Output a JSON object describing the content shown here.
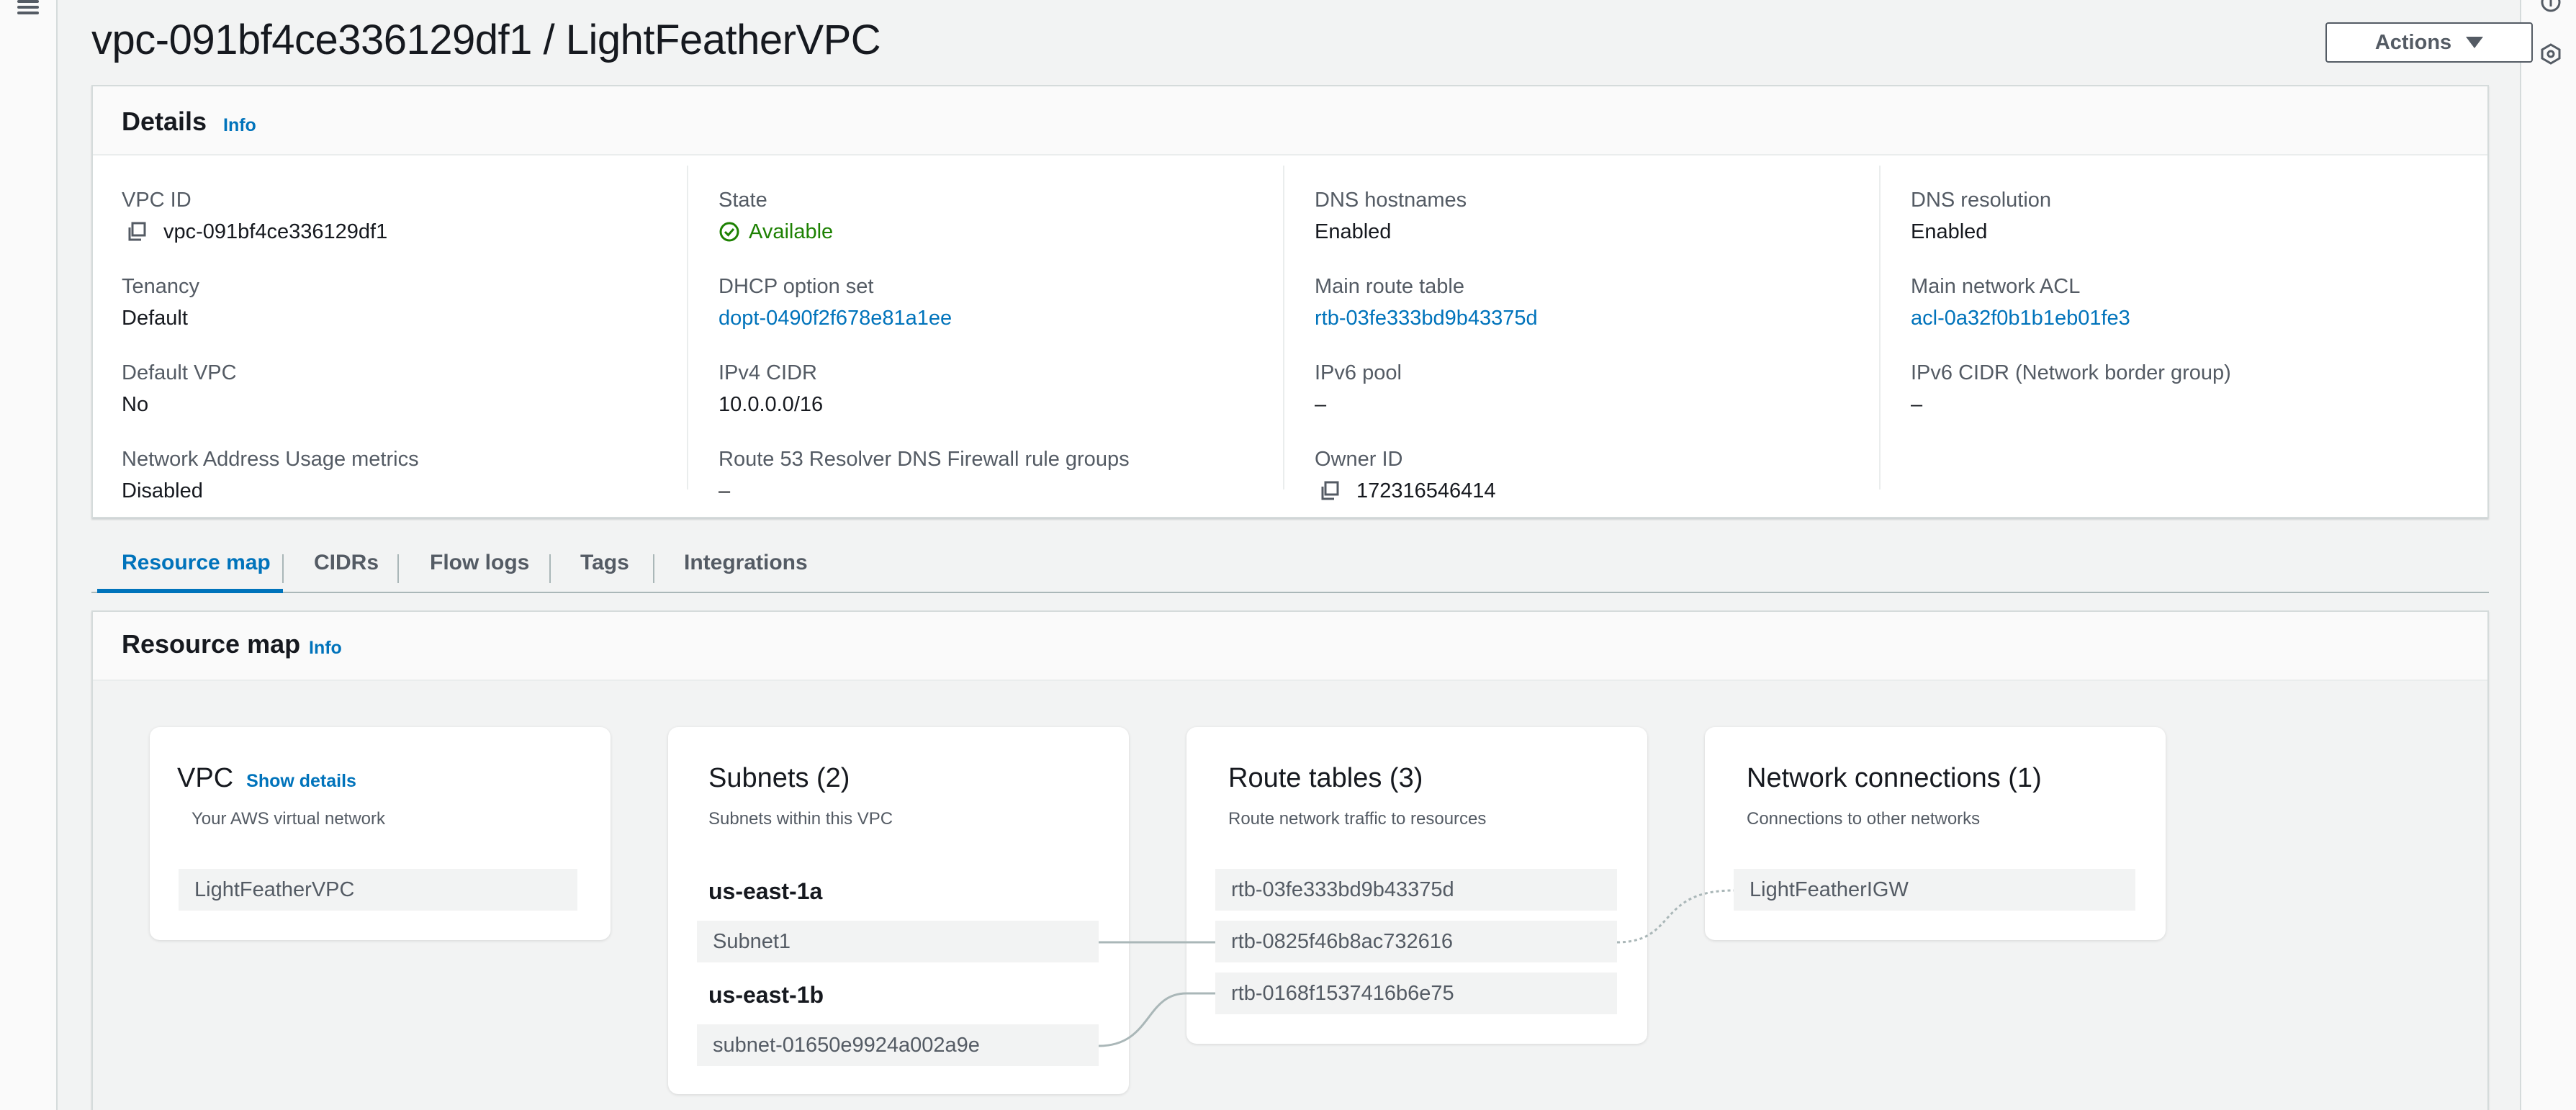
{
  "page": {
    "title": "vpc-091bf4ce336129df1 / LightFeatherVPC",
    "actions_label": "Actions"
  },
  "details": {
    "title": "Details",
    "info": "Info",
    "columns": [
      [
        {
          "label": "VPC ID",
          "value": "vpc-091bf4ce336129df1",
          "copyable": true
        },
        {
          "label": "Tenancy",
          "value": "Default"
        },
        {
          "label": "Default VPC",
          "value": "No"
        },
        {
          "label": "Network Address Usage metrics",
          "value": "Disabled"
        }
      ],
      [
        {
          "label": "State",
          "value": "Available",
          "status": "success"
        },
        {
          "label": "DHCP option set",
          "value": "dopt-0490f2f678e81a1ee",
          "link": true
        },
        {
          "label": "IPv4 CIDR",
          "value": "10.0.0.0/16"
        },
        {
          "label": "Route 53 Resolver DNS Firewall rule groups",
          "value": "–"
        }
      ],
      [
        {
          "label": "DNS hostnames",
          "value": "Enabled"
        },
        {
          "label": "Main route table",
          "value": "rtb-03fe333bd9b43375d",
          "link": true
        },
        {
          "label": "IPv6 pool",
          "value": "–"
        },
        {
          "label": "Owner ID",
          "value": "172316546414",
          "copyable": true
        }
      ],
      [
        {
          "label": "DNS resolution",
          "value": "Enabled"
        },
        {
          "label": "Main network ACL",
          "value": "acl-0a32f0b1b1eb01fe3",
          "link": true
        },
        {
          "label": "IPv6 CIDR (Network border group)",
          "value": "–"
        }
      ]
    ]
  },
  "tabs": [
    "Resource map",
    "CIDRs",
    "Flow logs",
    "Tags",
    "Integrations"
  ],
  "resource_map": {
    "title": "Resource map",
    "info": "Info",
    "vpc": {
      "title": "VPC",
      "show_details": "Show details",
      "subtitle": "Your AWS virtual network",
      "items": [
        "LightFeatherVPC"
      ]
    },
    "subnets": {
      "title": "Subnets (2)",
      "subtitle": "Subnets within this VPC",
      "zones": [
        {
          "name": "us-east-1a",
          "items": [
            "Subnet1"
          ]
        },
        {
          "name": "us-east-1b",
          "items": [
            "subnet-01650e9924a002a9e"
          ]
        }
      ]
    },
    "route_tables": {
      "title": "Route tables (3)",
      "subtitle": "Route network traffic to resources",
      "items": [
        "rtb-03fe333bd9b43375d",
        "rtb-0825f46b8ac732616",
        "rtb-0168f1537416b6e75"
      ]
    },
    "network_connections": {
      "title": "Network connections (1)",
      "subtitle": "Connections to other networks",
      "items": [
        "LightFeatherIGW"
      ]
    }
  },
  "colors": {
    "link": "#0073bb",
    "success": "#1d8102",
    "active_tab": "#0073bb",
    "page_bg": "#f2f3f3"
  }
}
